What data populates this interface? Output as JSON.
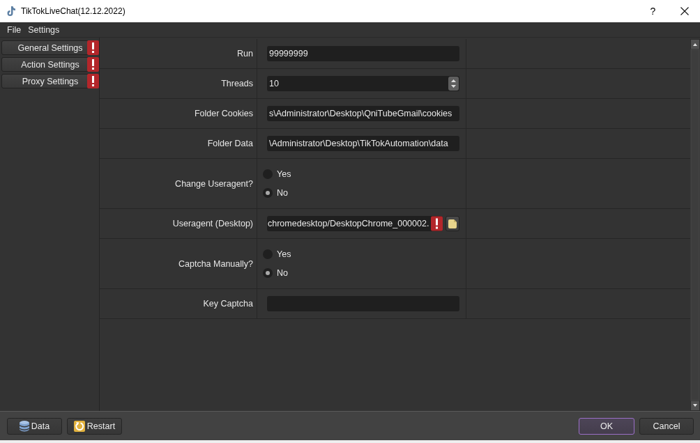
{
  "window": {
    "title": "TikTokLiveChat(12.12.2022)",
    "help_button": "?"
  },
  "menu": [
    {
      "label": "File"
    },
    {
      "label": "Settings"
    }
  ],
  "sidebar": {
    "items": [
      {
        "label": "General Settings",
        "selected": false,
        "warning": true
      },
      {
        "label": "Action Settings",
        "selected": false,
        "warning": true
      },
      {
        "label": "Proxy Settings",
        "selected": false,
        "warning": true
      }
    ]
  },
  "form": {
    "rows": [
      {
        "kind": "text",
        "label": "Run",
        "value": "99999999"
      },
      {
        "kind": "spin",
        "label": "Threads",
        "value": "10"
      },
      {
        "kind": "text",
        "label": "Folder Cookies",
        "value": "s\\Administrator\\Desktop\\QniTubeGmail\\cookies"
      },
      {
        "kind": "text",
        "label": "Folder Data",
        "value": "\\Administrator\\Desktop\\TikTokAutomation\\data"
      },
      {
        "kind": "radio",
        "label": "Change Useragent?",
        "options": [
          {
            "label": "Yes",
            "selected": false
          },
          {
            "label": "No",
            "selected": true
          }
        ]
      },
      {
        "kind": "file",
        "label": "Useragent (Desktop)",
        "value": "chromedesktop/DesktopChrome_000002.",
        "warning": true
      },
      {
        "kind": "radio",
        "label": "Captcha Manually?",
        "options": [
          {
            "label": "Yes",
            "selected": false
          },
          {
            "label": "No",
            "selected": true
          }
        ]
      },
      {
        "kind": "text",
        "label": "Key Captcha"
      }
    ]
  },
  "footer": {
    "left_buttons": [
      {
        "label": "Data"
      },
      {
        "label": "Restart"
      }
    ],
    "right_buttons": [
      {
        "label": "OK",
        "default": true
      },
      {
        "label": "Cancel",
        "default": false
      }
    ]
  }
}
